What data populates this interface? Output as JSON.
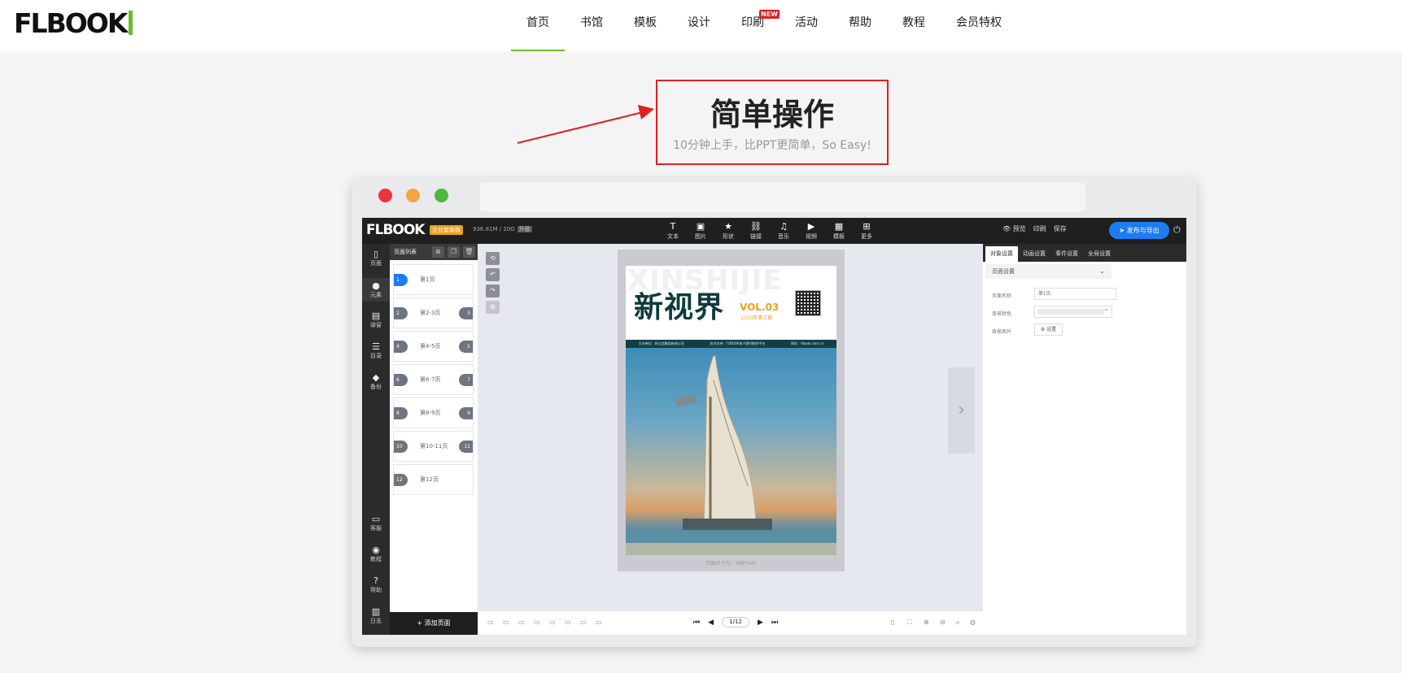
{
  "site": {
    "logo": "FLBOOK",
    "nav": [
      {
        "label": "首页",
        "active": true
      },
      {
        "label": "书馆"
      },
      {
        "label": "模板"
      },
      {
        "label": "设计"
      },
      {
        "label": "印刷",
        "badge": "NEW"
      },
      {
        "label": "活动"
      },
      {
        "label": "帮助"
      },
      {
        "label": "教程"
      },
      {
        "label": "会员特权"
      }
    ],
    "brand_color": "#6dbb2c"
  },
  "feature": {
    "title": "简单操作",
    "subtitle": "10分钟上手，比PPT更简单，So Easy!",
    "highlight_color": "#e02020"
  },
  "window": {
    "controls": [
      {
        "name": "close",
        "color": "#ee3340"
      },
      {
        "name": "minimize",
        "color": "#f5a444"
      },
      {
        "name": "maximize",
        "color": "#4cba3c"
      }
    ]
  },
  "editor": {
    "logo": "FLBOOK",
    "edition": "企业套装版",
    "storage": "936.81M / 20G",
    "upgrade": "升级",
    "tools": [
      {
        "icon": "T",
        "label": "文本"
      },
      {
        "icon": "▣",
        "label": "图片"
      },
      {
        "icon": "★",
        "label": "形状"
      },
      {
        "icon": "⛓",
        "label": "链接"
      },
      {
        "icon": "♫",
        "label": "音乐"
      },
      {
        "icon": "▶",
        "label": "视频"
      },
      {
        "icon": "▦",
        "label": "模板"
      },
      {
        "icon": "⊞",
        "label": "更多"
      }
    ],
    "right_actions": {
      "preview": "👁 预览",
      "print": "印刷",
      "save": "保存",
      "publish": "➤ 发布与导出",
      "power": "⏻"
    },
    "left_nav": [
      {
        "icon": "▯",
        "label": "页面"
      },
      {
        "icon": "●",
        "label": "元素"
      },
      {
        "icon": "▤",
        "label": "弹窗"
      },
      {
        "icon": "☰",
        "label": "目录"
      },
      {
        "icon": "◆",
        "label": "备份"
      },
      {
        "icon": "▭",
        "label": "客服"
      },
      {
        "icon": "◉",
        "label": "教程"
      },
      {
        "icon": "?",
        "label": "帮助"
      },
      {
        "icon": "▥",
        "label": "日志"
      }
    ],
    "page_list": {
      "title": "页面列表",
      "pages": [
        {
          "num": "1",
          "label": "第1页",
          "selected": true
        },
        {
          "num": "2",
          "num2": "3",
          "label": "第2-3页"
        },
        {
          "num": "4",
          "num2": "5",
          "label": "第4-5页"
        },
        {
          "num": "6",
          "num2": "7",
          "label": "第6-7页"
        },
        {
          "num": "8",
          "num2": "9",
          "label": "第8-9页"
        },
        {
          "num": "10",
          "num2": "11",
          "label": "第10-11页"
        },
        {
          "num": "12",
          "label": "第12页"
        }
      ],
      "add_page": "+ 添加页面"
    },
    "cover": {
      "watermark": "XINSHIJIE",
      "title": "新视界",
      "vol": "VOL.03",
      "year": "2020年第三期",
      "band": [
        "主办单位：新立信集团有限公司",
        "技术支持：FLBOOK电子期刊制作平台",
        "网址：flbook.com.cn"
      ]
    },
    "page_size": "页面尺寸为：368*541",
    "pager": {
      "first": "⏮",
      "prev": "◀",
      "current": "1/12",
      "next": "▶",
      "last": "⏭"
    },
    "next_arrow": "›",
    "right_panel": {
      "tabs": [
        "对象设置",
        "动画设置",
        "事件设置",
        "全局设置"
      ],
      "section": "页面设置",
      "fields": {
        "name_label": "页面名称",
        "name_placeholder": "第1页",
        "bgcolor_label": "背景颜色",
        "bgimage_label": "背景图片",
        "set_button": "⚙ 设置"
      }
    }
  }
}
